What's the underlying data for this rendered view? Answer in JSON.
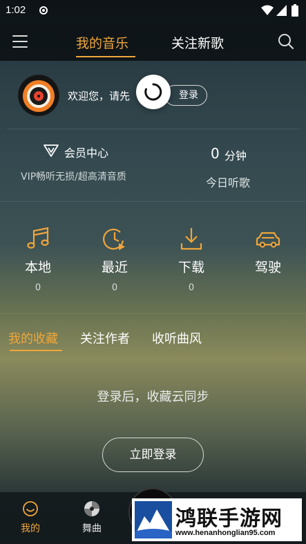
{
  "status_bar": {
    "time": "1:02"
  },
  "top_nav": {
    "tabs": [
      {
        "label": "我的音乐",
        "active": true
      },
      {
        "label": "关注新歌",
        "active": false
      }
    ]
  },
  "profile": {
    "welcome_text": "欢迎您，请先",
    "login_button": "登录"
  },
  "vip": {
    "title": "会员中心",
    "subtitle": "VIP畅听无损/超高清音质"
  },
  "listen_today": {
    "value": "0",
    "unit": "分钟",
    "label": "今日听歌"
  },
  "quick_access": [
    {
      "label": "本地",
      "count": "0",
      "icon": "music-note-icon"
    },
    {
      "label": "最近",
      "count": "0",
      "icon": "clock-play-icon"
    },
    {
      "label": "下载",
      "count": "0",
      "icon": "download-icon"
    },
    {
      "label": "驾驶",
      "count": "",
      "icon": "car-icon"
    }
  ],
  "sub_tabs": [
    {
      "label": "我的收藏",
      "active": true
    },
    {
      "label": "关注作者",
      "active": false
    },
    {
      "label": "收听曲风",
      "active": false
    }
  ],
  "empty_state": {
    "message": "登录后，收藏云同步",
    "login_now_button": "立即登录"
  },
  "bottom_nav": [
    {
      "label": "我的",
      "active": true,
      "icon": "smiley-icon"
    },
    {
      "label": "舞曲",
      "active": false,
      "icon": "disc-icon"
    }
  ],
  "watermark": {
    "title": "鸿联手游网",
    "url": "www.henanhonglian95.com"
  },
  "colors": {
    "accent": "#f0a63a",
    "nav_background": "#0a0f12",
    "text": "#ffffff"
  }
}
